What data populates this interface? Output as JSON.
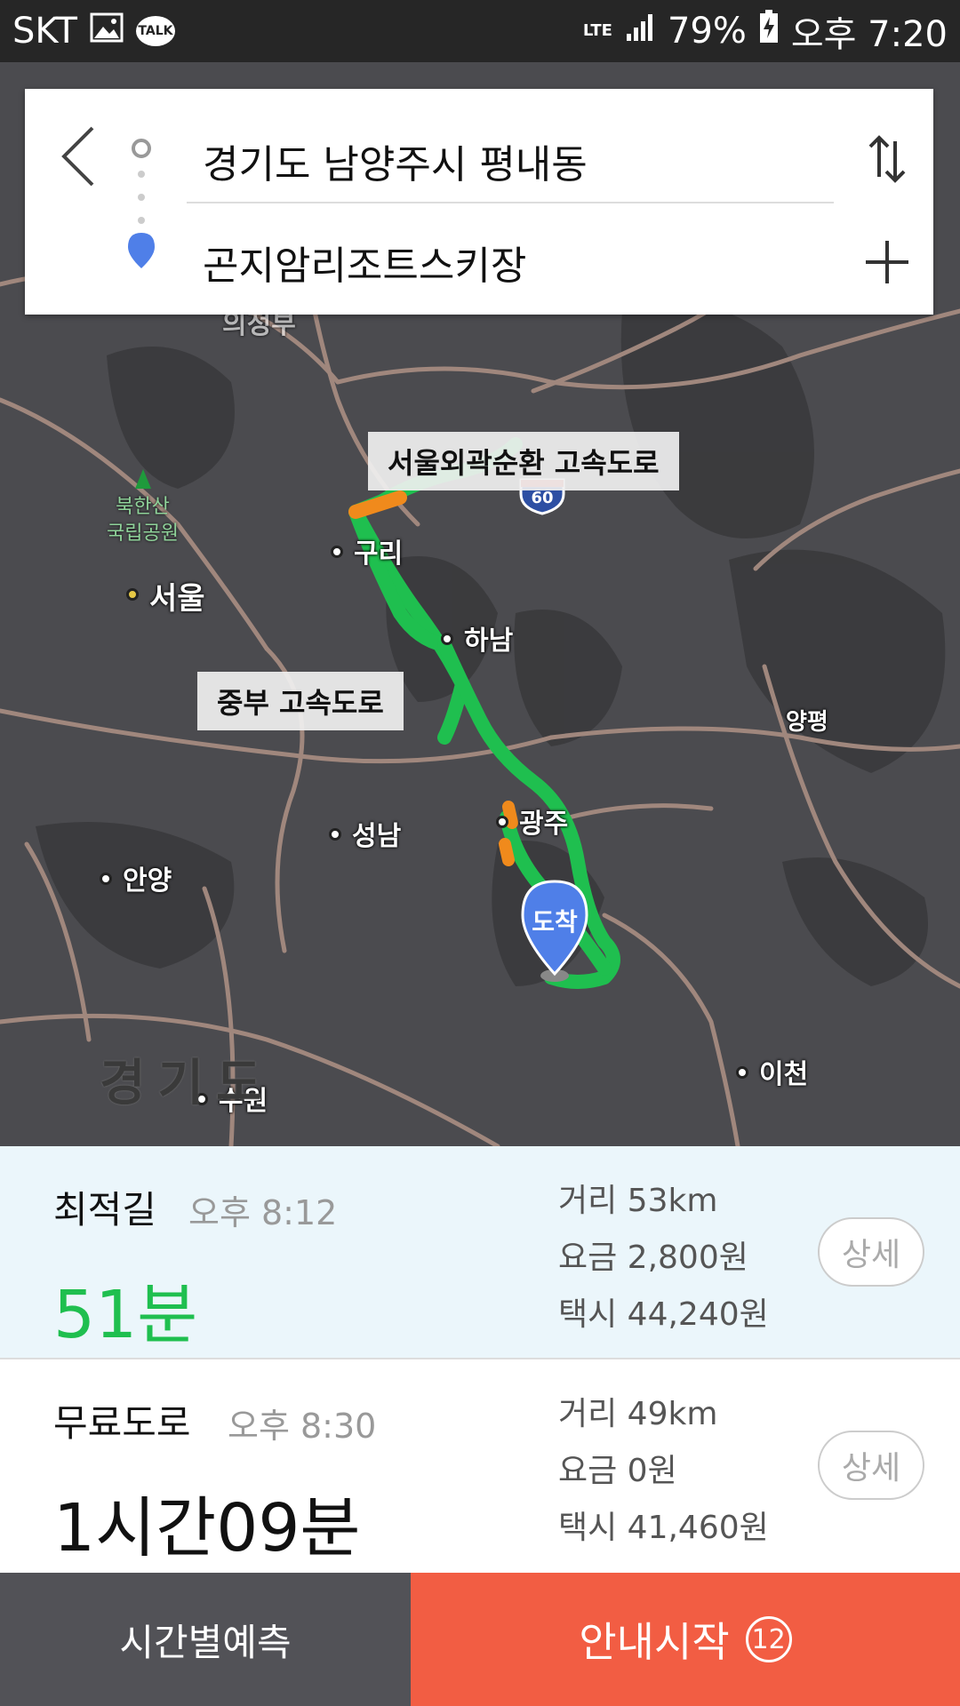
{
  "status_bar": {
    "carrier": "SKT",
    "talk_label": "TALK",
    "network": "LTE",
    "battery": "79%",
    "time": "오후 7:20"
  },
  "search": {
    "origin": "경기도 남양주시 평내동",
    "destination": "곤지암리조트스키장"
  },
  "map": {
    "labels": {
      "seoul": "서울",
      "guri": "구리",
      "hanam": "하남",
      "gwangju": "광주",
      "seongnam": "성남",
      "anyang": "안양",
      "suwon": "수원",
      "icheon": "이천",
      "yangpyeong": "양평",
      "gyeonggi": "경기도",
      "park": "북한산\n국립공원",
      "uijeongbu_partial": "의정부"
    },
    "callouts": {
      "ring_expressway": "서울외곽순환 고속도로",
      "jungbu_expressway": "중부 고속도로"
    },
    "highway_shield": "60",
    "destination_pin": "도착",
    "colors": {
      "route": "#1fbf4f",
      "congestion": "#f08a1c",
      "road": "#a0877d"
    }
  },
  "routes": [
    {
      "name": "최적길",
      "eta": "오후 8:12",
      "duration": "51분",
      "distance": "거리 53km",
      "toll": "요금 2,800원",
      "taxi": "택시 44,240원",
      "detail": "상세"
    },
    {
      "name": "무료도로",
      "eta": "오후 8:30",
      "duration": "1시간09분",
      "distance": "거리 49km",
      "toll": "요금 0원",
      "taxi": "택시 41,460원",
      "detail": "상세"
    }
  ],
  "bottom_bar": {
    "time_predict": "시간별예측",
    "start_guide": "안내시작",
    "countdown": "12"
  }
}
